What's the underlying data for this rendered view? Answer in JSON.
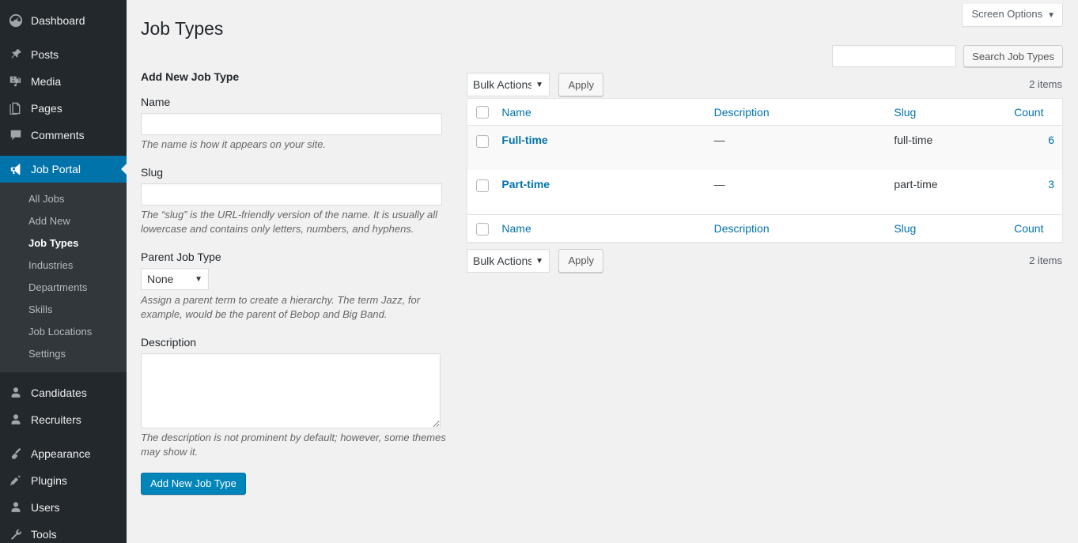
{
  "sidebar": {
    "items": [
      {
        "label": "Dashboard",
        "icon": "dashboard-icon",
        "name": "dashboard",
        "current": false
      },
      {
        "label": "Posts",
        "icon": "pin-icon",
        "name": "posts",
        "current": false
      },
      {
        "label": "Media",
        "icon": "media-icon",
        "name": "media",
        "current": false
      },
      {
        "label": "Pages",
        "icon": "pages-icon",
        "name": "pages",
        "current": false
      },
      {
        "label": "Comments",
        "icon": "comments-icon",
        "name": "comments",
        "current": false
      },
      {
        "label": "Job Portal",
        "icon": "megaphone-icon",
        "name": "job-portal",
        "current": true
      },
      {
        "label": "Candidates",
        "icon": "user-icon",
        "name": "candidates",
        "current": false
      },
      {
        "label": "Recruiters",
        "icon": "user-icon",
        "name": "recruiters",
        "current": false
      },
      {
        "label": "Appearance",
        "icon": "paintbrush-icon",
        "name": "appearance",
        "current": false
      },
      {
        "label": "Plugins",
        "icon": "plug-icon",
        "name": "plugins",
        "current": false
      },
      {
        "label": "Users",
        "icon": "user-icon",
        "name": "users",
        "current": false
      },
      {
        "label": "Tools",
        "icon": "wrench-icon",
        "name": "tools",
        "current": false
      }
    ],
    "submenu": [
      {
        "label": "All Jobs",
        "name": "all-jobs",
        "current": false
      },
      {
        "label": "Add New",
        "name": "add-new",
        "current": false
      },
      {
        "label": "Job Types",
        "name": "job-types",
        "current": true
      },
      {
        "label": "Industries",
        "name": "industries",
        "current": false
      },
      {
        "label": "Departments",
        "name": "departments",
        "current": false
      },
      {
        "label": "Skills",
        "name": "skills",
        "current": false
      },
      {
        "label": "Job Locations",
        "name": "job-locations",
        "current": false
      },
      {
        "label": "Settings",
        "name": "settings",
        "current": false
      }
    ],
    "colors": {
      "background": "#23282d",
      "submenu_background": "#32373c",
      "current_background": "#0073aa"
    }
  },
  "header": {
    "screen_options_label": "Screen Options",
    "screen_options_caret": "▼",
    "page_title": "Job Types"
  },
  "search": {
    "value": "",
    "placeholder": "",
    "button_label": "Search Job Types"
  },
  "form": {
    "heading": "Add New Job Type",
    "name_label": "Name",
    "name_value": "",
    "name_desc": "The name is how it appears on your site.",
    "slug_label": "Slug",
    "slug_value": "",
    "slug_desc": "The “slug” is the URL-friendly version of the name. It is usually all lowercase and contains only letters, numbers, and hyphens.",
    "parent_label": "Parent Job Type",
    "parent_selected": "None",
    "parent_options": [
      "None"
    ],
    "parent_desc": "Assign a parent term to create a hierarchy. The term Jazz, for example, would be the parent of Bebop and Big Band.",
    "description_label": "Description",
    "description_value": "",
    "description_desc": "The description is not prominent by default; however, some themes may show it.",
    "submit_label": "Add New Job Type"
  },
  "tablenav": {
    "bulk_selected": "Bulk Actions",
    "bulk_options": [
      "Bulk Actions"
    ],
    "bulk_caret": "▼",
    "apply_label": "Apply",
    "items_count_top": "2 items",
    "items_count_bottom": "2 items"
  },
  "table": {
    "columns": [
      {
        "key": "cb",
        "label": ""
      },
      {
        "key": "name",
        "label": "Name"
      },
      {
        "key": "description",
        "label": "Description"
      },
      {
        "key": "slug",
        "label": "Slug"
      },
      {
        "key": "count",
        "label": "Count"
      }
    ],
    "rows": [
      {
        "name": "Full-time",
        "description": "—",
        "slug": "full-time",
        "count": "6"
      },
      {
        "name": "Part-time",
        "description": "—",
        "slug": "part-time",
        "count": "3"
      }
    ]
  },
  "colors": {
    "accent": "#0073aa",
    "button_primary": "#0085ba",
    "link": "#0073aa",
    "page_background": "#f1f1f1"
  }
}
